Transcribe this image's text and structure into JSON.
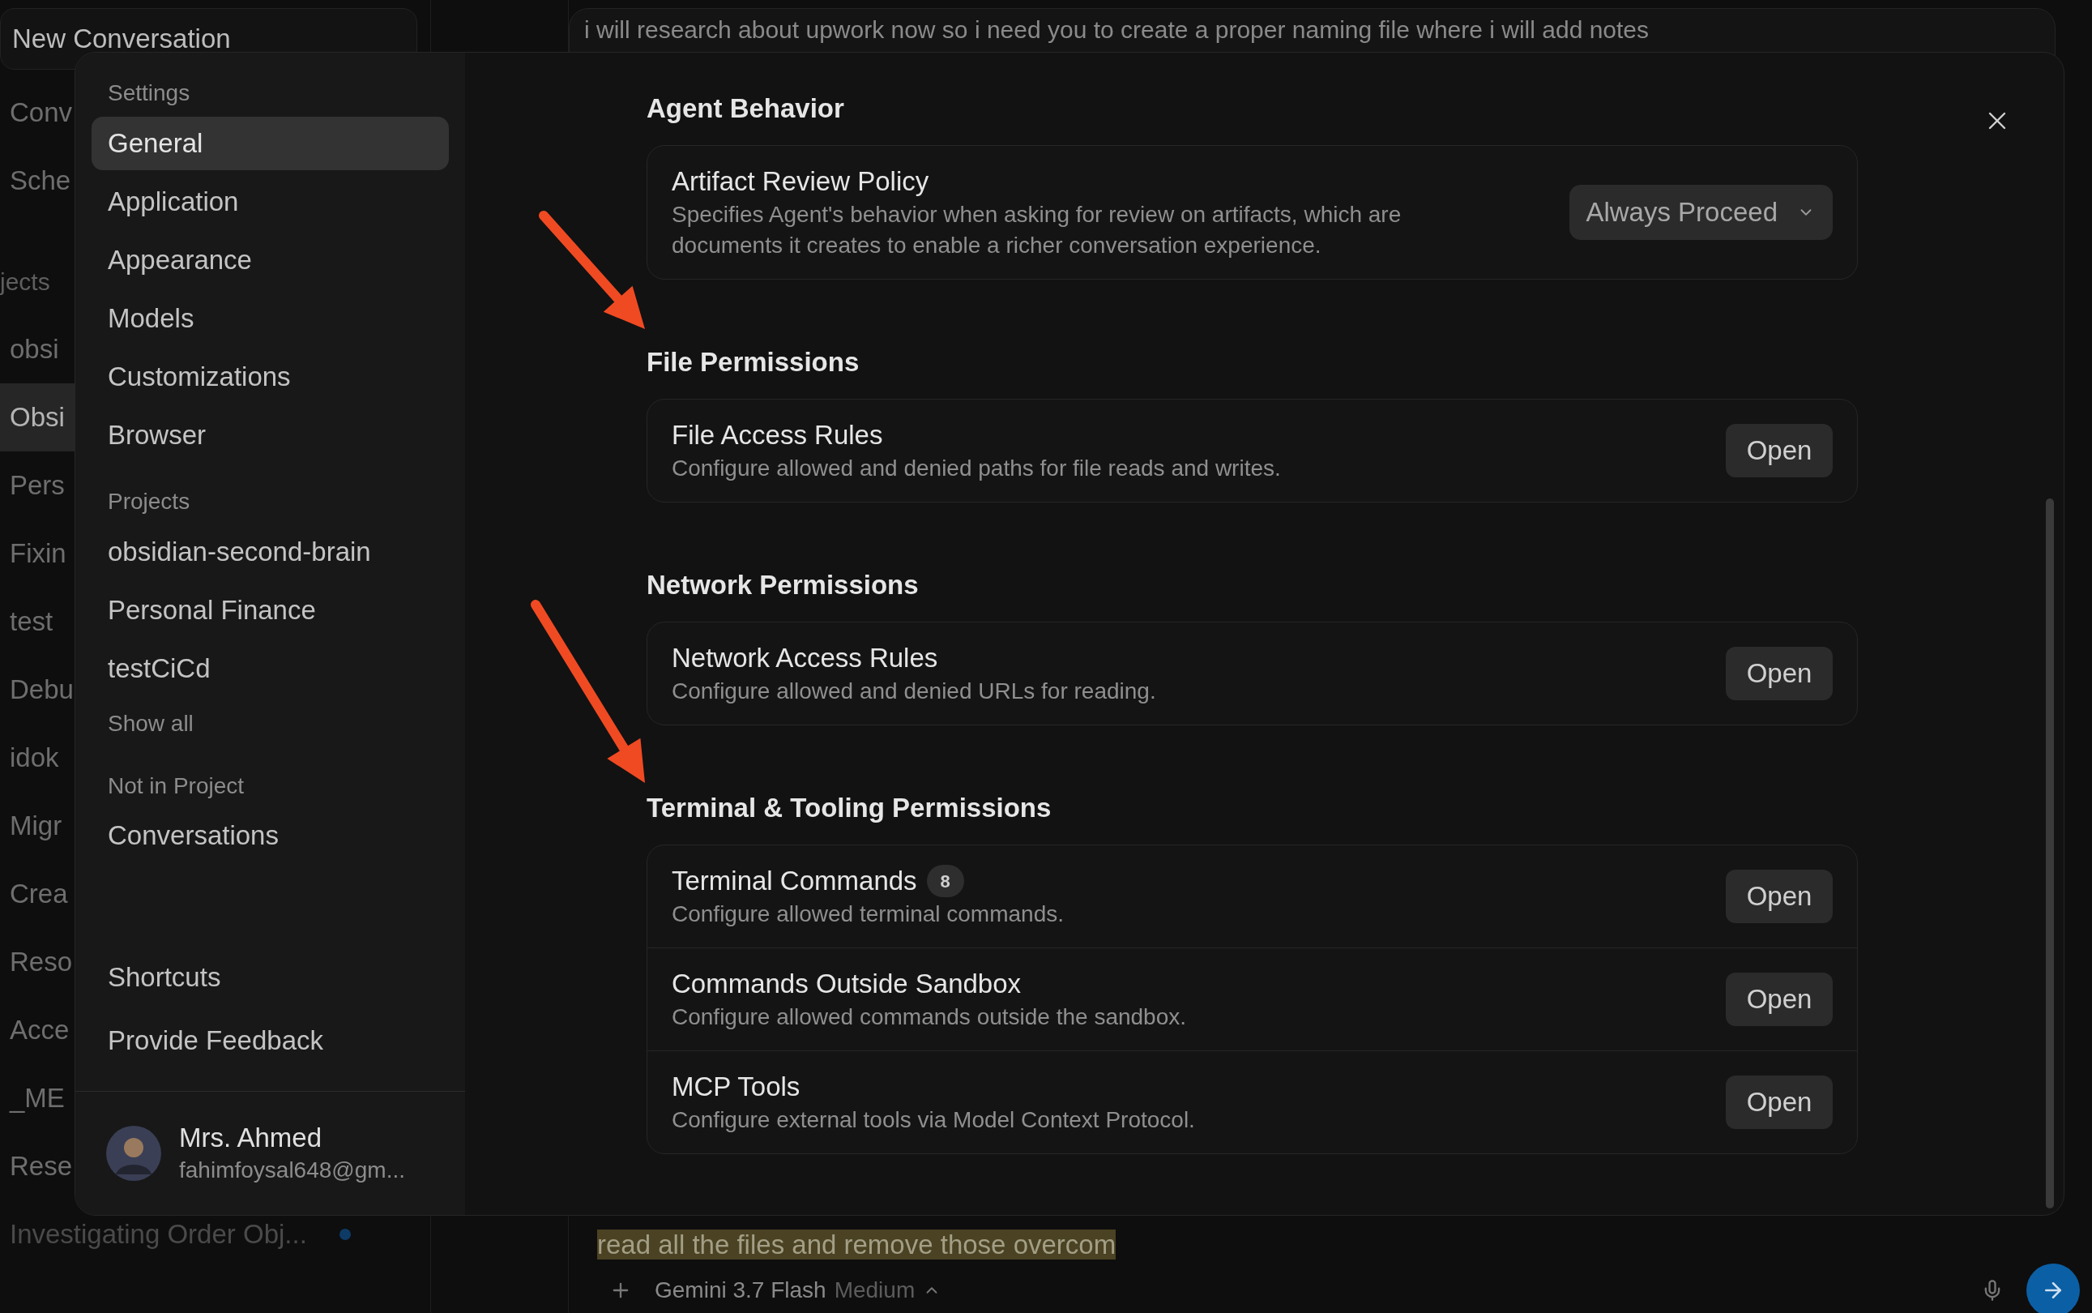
{
  "background": {
    "new_conversation": "New Conversation",
    "sidebar": [
      {
        "kind": "item",
        "label": "Conv",
        "selected": false
      },
      {
        "kind": "item",
        "label": "Sche",
        "selected": false
      },
      {
        "kind": "header",
        "label": "jects"
      },
      {
        "kind": "item",
        "label": "obsi",
        "selected": false
      },
      {
        "kind": "item",
        "label": "Obsi",
        "selected": true
      },
      {
        "kind": "item",
        "label": "Pers",
        "selected": false
      },
      {
        "kind": "item",
        "label": "Fixin",
        "selected": false
      },
      {
        "kind": "item",
        "label": "test",
        "selected": false
      },
      {
        "kind": "item",
        "label": "Debu",
        "selected": false
      },
      {
        "kind": "item",
        "label": "idok",
        "selected": false
      },
      {
        "kind": "item",
        "label": "Migr",
        "selected": false
      },
      {
        "kind": "item",
        "label": "Crea",
        "selected": false
      },
      {
        "kind": "item",
        "label": "Reso",
        "selected": false
      },
      {
        "kind": "item",
        "label": "Acce",
        "selected": false
      },
      {
        "kind": "item",
        "label": "_ME",
        "selected": false
      },
      {
        "kind": "item",
        "label": "Rese",
        "selected": false
      }
    ],
    "last_conversation": {
      "label": "Investigating Order Obj...",
      "unread": true
    },
    "message": "i will research about upwork now so i need you to create a proper naming file where i will add notes",
    "input_text": "read all the files and remove those overcom",
    "model": "Gemini 3.7 Flash",
    "model_mode": "Medium"
  },
  "settings": {
    "title": "Settings",
    "nav": [
      {
        "label": "General",
        "selected": true
      },
      {
        "label": "Application",
        "selected": false
      },
      {
        "label": "Appearance",
        "selected": false
      },
      {
        "label": "Models",
        "selected": false
      },
      {
        "label": "Customizations",
        "selected": false
      },
      {
        "label": "Browser",
        "selected": false
      }
    ],
    "projects_heading": "Projects",
    "projects": [
      {
        "label": "obsidian-second-brain",
        "selected": false
      },
      {
        "label": "Personal Finance",
        "selected": false
      },
      {
        "label": "testCiCd",
        "selected": false
      }
    ],
    "show_all": "Show all",
    "not_in_project_heading": "Not in Project",
    "not_in_project": [
      {
        "label": "Conversations",
        "selected": false
      }
    ],
    "footer_links": [
      "Shortcuts",
      "Provide Feedback"
    ],
    "user": {
      "name": "Mrs. Ahmed",
      "email": "fahimfoysal648@gm..."
    }
  },
  "sections": [
    {
      "title": "Agent Behavior",
      "rows": [
        {
          "kind": "select",
          "title": "Artifact Review Policy",
          "description": "Specifies Agent's behavior when asking for review on artifacts, which are documents it creates to enable a richer conversation experience.",
          "value": "Always Proceed"
        }
      ]
    },
    {
      "title": "File Permissions",
      "rows": [
        {
          "kind": "button",
          "title": "File Access Rules",
          "description": "Configure allowed and denied paths for file reads and writes.",
          "button": "Open"
        }
      ]
    },
    {
      "title": "Network Permissions",
      "rows": [
        {
          "kind": "button",
          "title": "Network Access Rules",
          "description": "Configure allowed and denied URLs for reading.",
          "button": "Open"
        }
      ]
    },
    {
      "title": "Terminal & Tooling Permissions",
      "rows": [
        {
          "kind": "button",
          "title": "Terminal Commands",
          "badge": "8",
          "description": "Configure allowed terminal commands.",
          "button": "Open"
        },
        {
          "kind": "button",
          "title": "Commands Outside Sandbox",
          "description": "Configure allowed commands outside the sandbox.",
          "button": "Open"
        },
        {
          "kind": "button",
          "title": "MCP Tools",
          "description": "Configure external tools via Model Context Protocol.",
          "button": "Open"
        }
      ]
    }
  ]
}
